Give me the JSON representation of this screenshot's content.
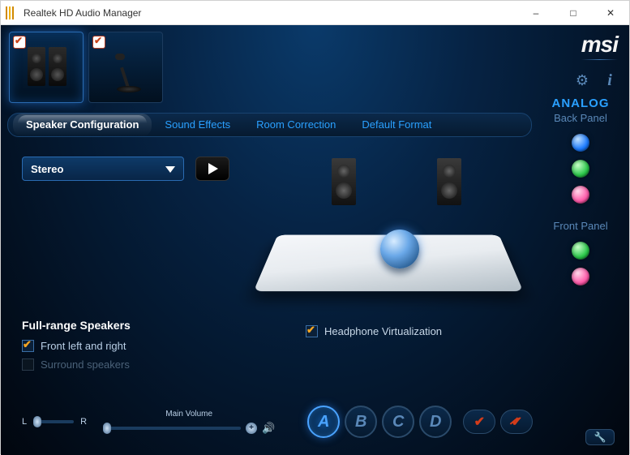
{
  "titlebar": {
    "title": "Realtek HD Audio Manager"
  },
  "brand": "msi",
  "device_tabs": [
    {
      "name": "speakers",
      "checked": true,
      "active": true
    },
    {
      "name": "microphone",
      "checked": true,
      "active": false
    }
  ],
  "tabs": {
    "items": [
      {
        "label": "Speaker Configuration",
        "active": true
      },
      {
        "label": "Sound Effects",
        "active": false
      },
      {
        "label": "Room Correction",
        "active": false
      },
      {
        "label": "Default Format",
        "active": false
      }
    ]
  },
  "config": {
    "dropdown": "Stereo",
    "fullrange": {
      "heading": "Full-range Speakers",
      "front": {
        "label": "Front left and right",
        "checked": true,
        "enabled": true
      },
      "surround": {
        "label": "Surround speakers",
        "checked": false,
        "enabled": false
      }
    },
    "headphone_virtualization": {
      "label": "Headphone Virtualization",
      "checked": true
    }
  },
  "bottom": {
    "balance": {
      "left": "L",
      "right": "R"
    },
    "main_volume": {
      "label": "Main Volume",
      "plus": "+",
      "mute_icon": "volume-icon"
    },
    "presets": [
      "A",
      "B",
      "C",
      "D"
    ],
    "active_preset": 0
  },
  "right": {
    "analog": "ANALOG",
    "back_panel": "Back Panel",
    "front_panel": "Front Panel",
    "back_jacks": [
      "blue",
      "green",
      "pink"
    ],
    "front_jacks": [
      "green",
      "pink"
    ]
  }
}
